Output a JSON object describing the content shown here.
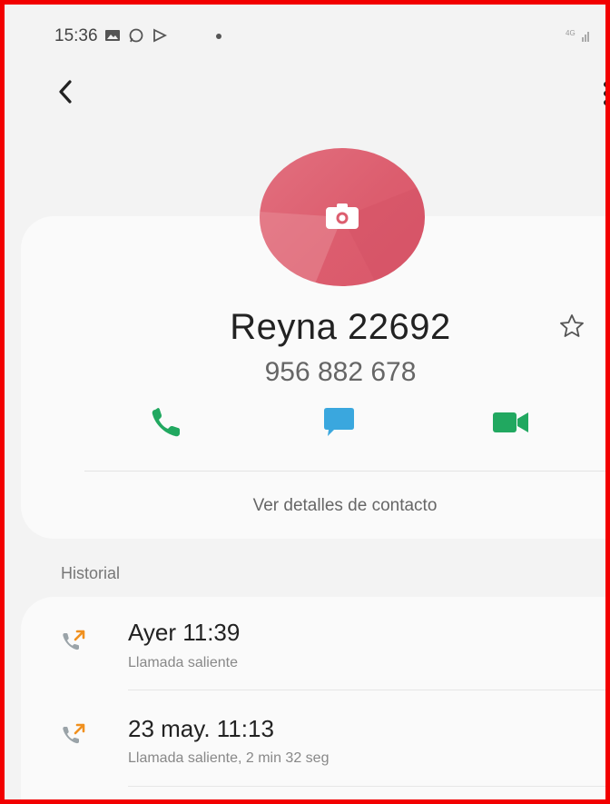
{
  "status": {
    "time": "15:36"
  },
  "contact": {
    "name": "Reyna 22692",
    "phone": "956 882 678",
    "details_link": "Ver detalles de contacto"
  },
  "colors": {
    "avatar": "#dc5d6e",
    "call": "#21a860",
    "message": "#3aa7de",
    "video": "#21a860",
    "outgoing_arrow": "#f0901e"
  },
  "history": {
    "label": "Historial",
    "calls": [
      {
        "title": "Ayer 11:39",
        "subtitle": "Llamada saliente",
        "icon": "outgoing-call-icon"
      },
      {
        "title": "23 may. 11:13",
        "subtitle": "Llamada saliente, 2 min 32 seg",
        "icon": "outgoing-call-icon"
      }
    ]
  }
}
